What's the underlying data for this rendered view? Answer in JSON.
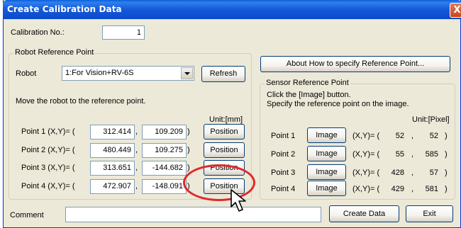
{
  "window": {
    "title": "Create Calibration Data",
    "close_label": "X"
  },
  "calibration": {
    "label": "Calibration No.:",
    "value": "1"
  },
  "robot_group": {
    "title": "Robot Reference Point",
    "robot_label": "Robot",
    "robot_selected": "1:For Vision+RV-6S",
    "refresh_label": "Refresh",
    "instruction": "Move the robot to the reference point.",
    "unit": "Unit:[mm]",
    "points": [
      {
        "label": "Point 1 (X,Y)= (",
        "x": "312.414",
        "sep": ",",
        "y": "109.209",
        "close": ")",
        "button": "Position"
      },
      {
        "label": "Point 2 (X,Y)= (",
        "x": "480.449",
        "sep": ",",
        "y": "109.275",
        "close": ")",
        "button": "Position"
      },
      {
        "label": "Point 3 (X,Y)= (",
        "x": "313.651",
        "sep": ",",
        "y": "-144.682",
        "close": ")",
        "button": "Position"
      },
      {
        "label": "Point 4 (X,Y)= (",
        "x": "472.907",
        "sep": ",",
        "y": "-148.091",
        "close": ")",
        "button": "Position"
      }
    ]
  },
  "about_button": "About How to specify Reference Point...",
  "sensor_group": {
    "title": "Sensor Reference Point",
    "instruction1": "Click the [Image] button.",
    "instruction2": "Specify the reference point on the image.",
    "unit": "Unit:[Pixel]",
    "points": [
      {
        "label": "Point 1",
        "button": "Image",
        "xy": "(X,Y)= (",
        "x": "52",
        "sep": ",",
        "y": "52",
        "close": ")"
      },
      {
        "label": "Point 2",
        "button": "Image",
        "xy": "(X,Y)= (",
        "x": "55",
        "sep": ",",
        "y": "585",
        "close": ")"
      },
      {
        "label": "Point 3",
        "button": "Image",
        "xy": "(X,Y)= (",
        "x": "428",
        "sep": ",",
        "y": "57",
        "close": ")"
      },
      {
        "label": "Point 4",
        "button": "Image",
        "xy": "(X,Y)= (",
        "x": "429",
        "sep": ",",
        "y": "581",
        "close": ")"
      }
    ]
  },
  "comment": {
    "label": "Comment",
    "value": ""
  },
  "footer": {
    "create_label": "Create Data",
    "exit_label": "Exit"
  },
  "icons": {
    "pointer": "mouse-pointer-icon",
    "close": "close-icon",
    "dropdown": "chevron-down-icon"
  },
  "colors": {
    "title_bar": "#0b4bcc",
    "dialog_bg": "#ece9d8",
    "highlight": "#e0282a"
  }
}
